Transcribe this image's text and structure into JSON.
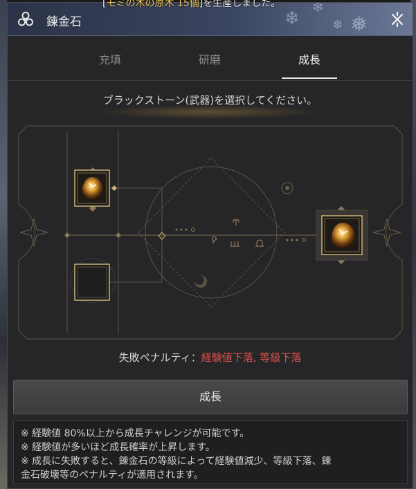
{
  "notification": {
    "prefix": "[",
    "item": "モミの木の原木 15個",
    "suffix": "]を生産しました。"
  },
  "window": {
    "title": "錬金石",
    "close_icon": "close-icon"
  },
  "tabs": [
    {
      "label": "充填",
      "active": false
    },
    {
      "label": "研磨",
      "active": false
    },
    {
      "label": "成長",
      "active": true
    }
  ],
  "instruction": "ブラックストーン(武器)を選択してください。",
  "penalty": {
    "label": "失敗ペナルティ：",
    "value": "経験値下落, 等級下落"
  },
  "grow_button": "成長",
  "notes": [
    "※ 経験値 80%以上から成長チャレンジが可能です。",
    "※ 経験値が多いほど成長確率が上昇します。",
    "※ 成長に失敗すると、錬金石の等級によって経験値減少、等級下落、錬",
    "金石破壊等のペナルティが適用されます。"
  ],
  "colors": {
    "accent_gold": "#b49a64",
    "penalty_red": "#e0514a",
    "title_bar": "#3a4560"
  },
  "icons": [
    "triskelion-icon",
    "close-icon",
    "alchemy-stone-icon",
    "compass-star-icon",
    "moon-icon"
  ]
}
